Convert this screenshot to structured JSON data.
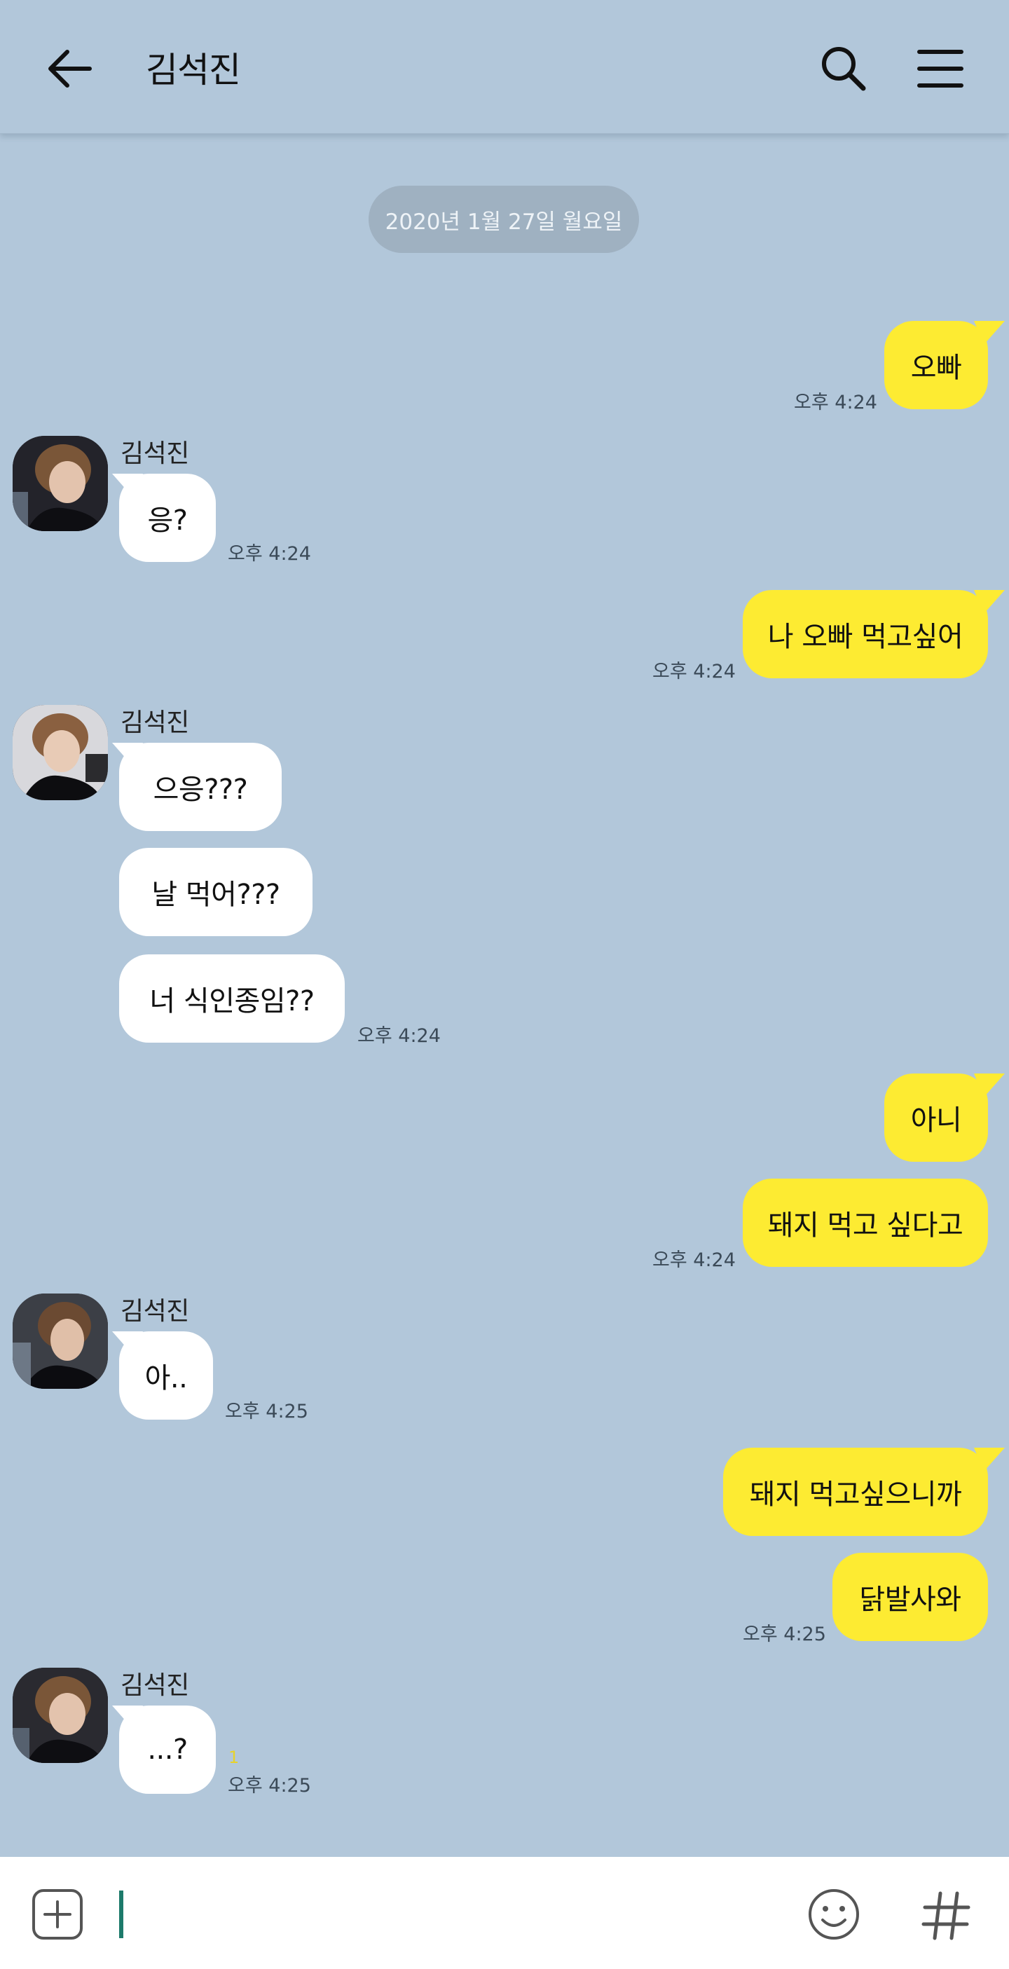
{
  "header": {
    "title": "김석진"
  },
  "date_divider": "2020년 1월 27일 월요일",
  "contact_name": "김석진",
  "messages": {
    "m1": {
      "text": "오빠",
      "time": "오후 4:24"
    },
    "m2": {
      "sender": "김석진",
      "text": "응?",
      "time": "오후 4:24"
    },
    "m3": {
      "text": "나 오빠 먹고싶어",
      "time": "오후 4:24"
    },
    "m4": {
      "sender": "김석진",
      "text": "으응???"
    },
    "m5": {
      "text": "날 먹어???"
    },
    "m6": {
      "text": "너 식인종임??",
      "time": "오후 4:24"
    },
    "m7": {
      "text": "아니"
    },
    "m8": {
      "text": "돼지 먹고 싶다고",
      "time": "오후 4:24"
    },
    "m9": {
      "sender": "김석진",
      "text": "아..",
      "time": "오후 4:25"
    },
    "m10": {
      "text": "돼지 먹고싶으니까"
    },
    "m11": {
      "text": "닭발사와",
      "time": "오후 4:25"
    },
    "m12": {
      "sender": "김석진",
      "text": "...?",
      "unread": "1",
      "time": "오후 4:25"
    }
  },
  "colors": {
    "background": "#b2c7da",
    "my_bubble": "#fdeb32",
    "their_bubble": "#ffffff",
    "cursor": "#1d7a6b"
  },
  "icons": {
    "back": "arrow-left-icon",
    "search": "search-icon",
    "menu": "hamburger-menu-icon",
    "plus": "plus-square-icon",
    "emoji": "smiley-icon",
    "hash": "hash-icon"
  }
}
